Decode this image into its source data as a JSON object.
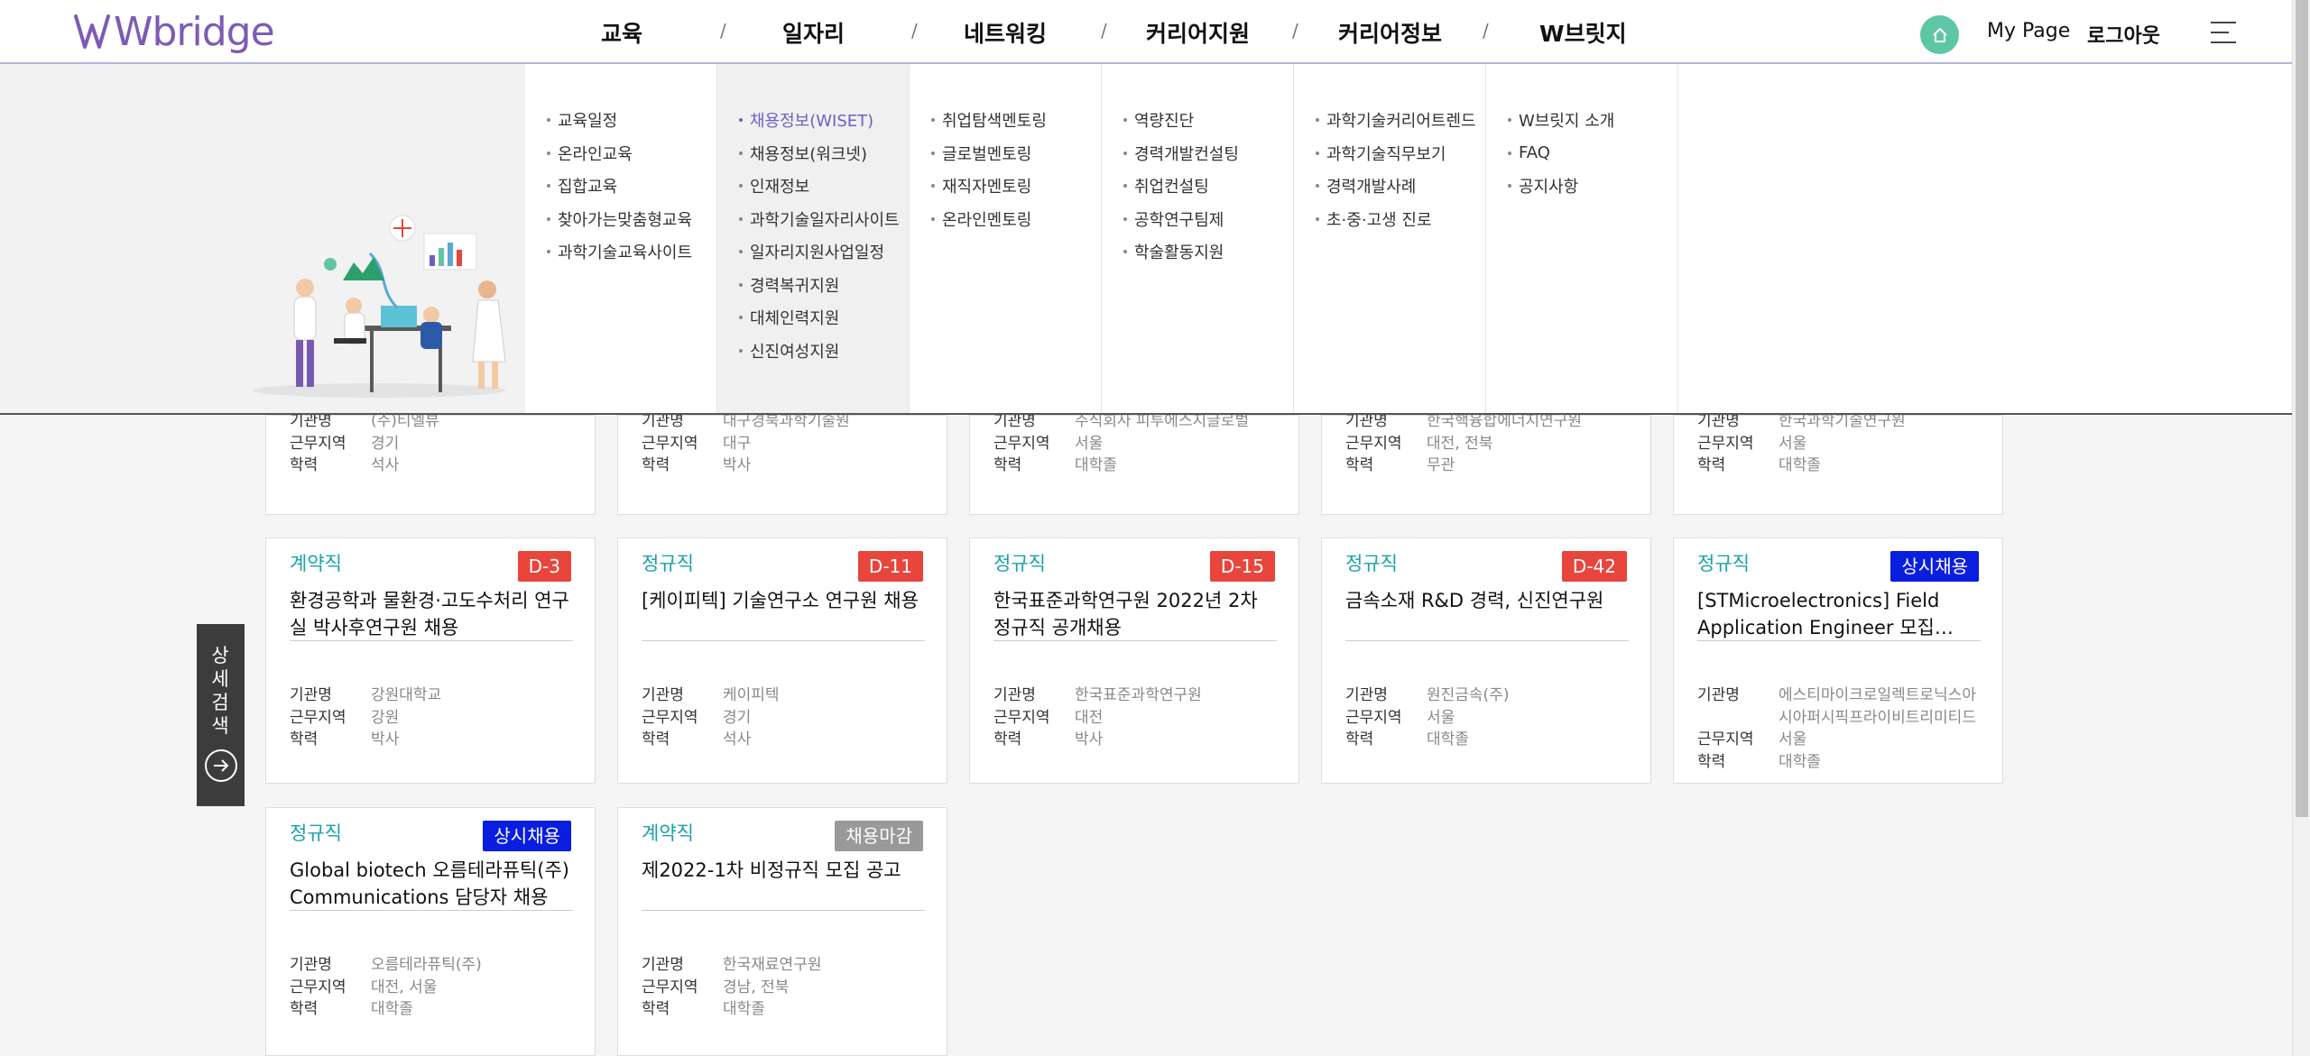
{
  "header": {
    "logo_text": "Wbridge",
    "nav": [
      "교육",
      "일자리",
      "네트워킹",
      "커리어지원",
      "커리어정보",
      "W브릿지"
    ],
    "mypage_label": "My Page",
    "logout_label": "로그아웃"
  },
  "mega_menu": [
    {
      "items": [
        "교육일정",
        "온라인교육",
        "집합교육",
        "찾아가는맞춤형교육",
        "과학기술교육사이트"
      ]
    },
    {
      "items": [
        "채용정보(WISET)",
        "채용정보(워크넷)",
        "인재정보",
        "과학기술일자리사이트",
        "일자리지원사업일정",
        "경력복귀지원",
        "대체인력지원",
        "신진여성지원"
      ],
      "active": "채용정보(WISET)"
    },
    {
      "items": [
        "취업탐색멘토링",
        "글로벌멘토링",
        "재직자멘토링",
        "온라인멘토링"
      ]
    },
    {
      "items": [
        "역량진단",
        "경력개발컨설팅",
        "취업컨설팅",
        "공학연구팀제",
        "학술활동지원"
      ]
    },
    {
      "items": [
        "과학기술커리어트렌드",
        "과학기술직무보기",
        "경력개발사례",
        "초·중·고생 진로"
      ]
    },
    {
      "items": [
        "W브릿지 소개",
        "FAQ",
        "공지사항"
      ]
    }
  ],
  "labels": {
    "org": "기관명",
    "region": "근무지역",
    "edu": "학력"
  },
  "partial_cards": [
    {
      "org": "(주)티엘뷰",
      "region": "경기",
      "edu": "석사"
    },
    {
      "org": "대구경북과학기술원",
      "region": "대구",
      "edu": "박사"
    },
    {
      "org": "주식회사 피투에스지글로벌",
      "region": "서울",
      "edu": "대학졸"
    },
    {
      "org": "한국핵융합에너지연구원",
      "region": "대전, 전북",
      "edu": "무관"
    },
    {
      "org": "한국과학기술연구원",
      "region": "서울",
      "edu": "대학졸"
    }
  ],
  "cards": [
    {
      "type": "계약직",
      "badge": "D-3",
      "title": "환경공학과 물환경·고도수처리 연구실 박사후연구원 채용",
      "org": "강원대학교",
      "region": "강원",
      "edu": "박사"
    },
    {
      "type": "정규직",
      "badge": "D-11",
      "title": "[케이피텍] 기술연구소 연구원 채용",
      "org": "케이피텍",
      "region": "경기",
      "edu": "석사"
    },
    {
      "type": "정규직",
      "badge": "D-15",
      "title": "한국표준과학연구원 2022년 2차 정규직 공개채용",
      "org": "한국표준과학연구원",
      "region": "대전",
      "edu": "박사"
    },
    {
      "type": "정규직",
      "badge": "D-42",
      "title": "금속소재 R&D 경력, 신진연구원",
      "org": "원진금속(주)",
      "region": "서울",
      "edu": "대학졸"
    },
    {
      "type": "정규직",
      "badge": "상시채용",
      "title": "[STMicroelectronics] Field Application Engineer 모집…",
      "org": "에스티마이크로일렉트로닉스아시아퍼시픽프라이비트리미티드",
      "region": "서울",
      "edu": "대학졸"
    },
    {
      "type": "정규직",
      "badge": "상시채용",
      "title": "Global biotech 오름테라퓨틱(주) Communications 담당자 채용",
      "org": "오름테라퓨틱(주)",
      "region": "대전, 서울",
      "edu": "대학졸"
    },
    {
      "type": "계약직",
      "badge": "채용마감",
      "title": "제2022-1차 비정규직 모집 공고",
      "org": "한국재료연구원",
      "region": "경남, 전북",
      "edu": "대학졸"
    }
  ],
  "side_search_label": "상세검색",
  "colors": {
    "accent": "#6f5fc0",
    "type_text": "#19a2a8",
    "badge_deadline": "#e8453c",
    "badge_always": "#0a1ee0",
    "badge_closed": "#999999",
    "home": "#5fc6a5"
  }
}
